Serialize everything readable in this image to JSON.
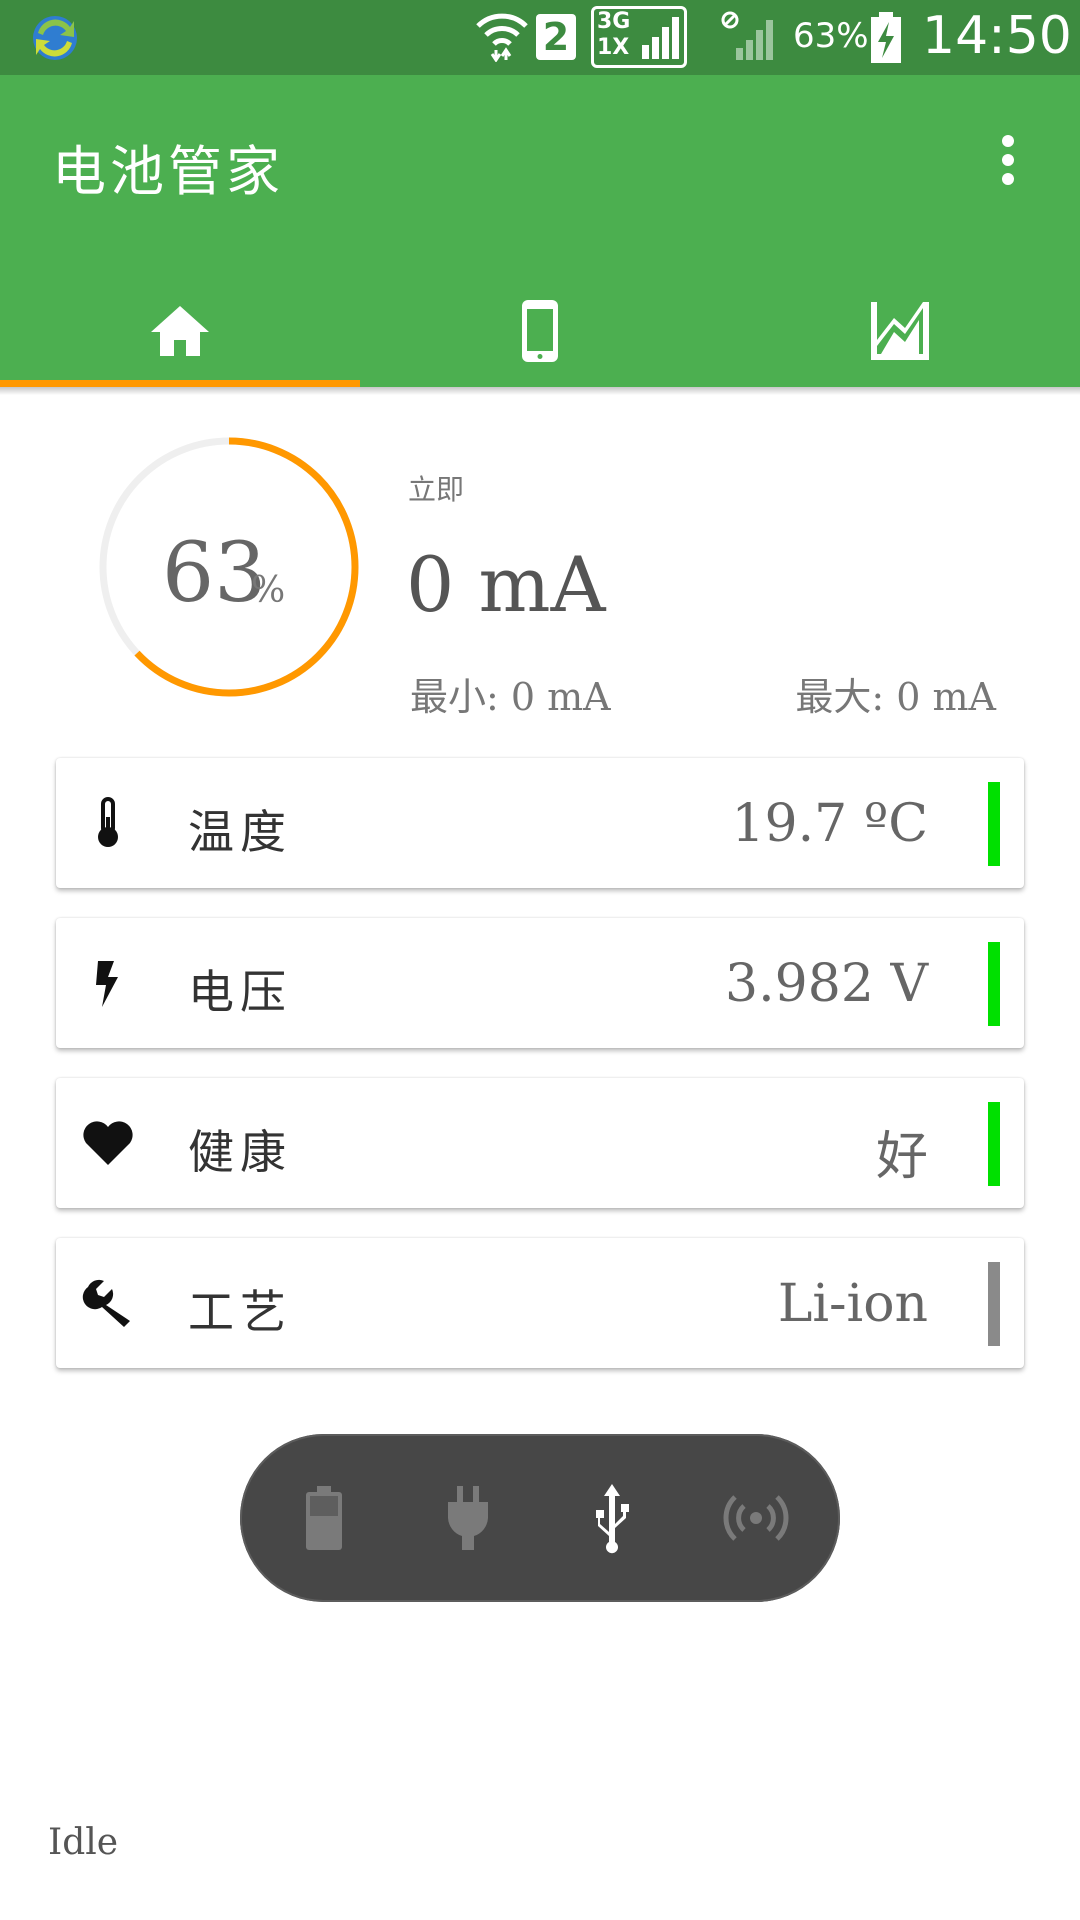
{
  "status_bar": {
    "battery_percent": "63%",
    "time": "14:50",
    "sim_slot": "2",
    "network_top": "3G",
    "network_bottom": "1X"
  },
  "toolbar": {
    "title": "电池管家",
    "tabs": [
      {
        "icon": "home-icon",
        "selected": true
      },
      {
        "icon": "phone-icon",
        "selected": false
      },
      {
        "icon": "chart-icon",
        "selected": false
      }
    ]
  },
  "gauge": {
    "percent_value": "63",
    "percent_unit": "%",
    "level_fraction": 0.63
  },
  "current": {
    "label": "立即",
    "value": "0 mA",
    "min": "最小: 0 mA",
    "max": "最大: 0 mA"
  },
  "cards": [
    {
      "icon": "thermometer-icon",
      "label": "温度",
      "value": "19.7 ºC",
      "indicator_color": "#00e000"
    },
    {
      "icon": "lightning-icon",
      "label": "电压",
      "value": "3.982 V",
      "indicator_color": "#00e000"
    },
    {
      "icon": "heart-icon",
      "label": "健康",
      "value": "好",
      "indicator_color": "#00e000"
    },
    {
      "icon": "wrench-icon",
      "label": "工艺",
      "value": "Li-ion",
      "indicator_color": "#8a8a8a"
    }
  ],
  "power_source": {
    "options": [
      "battery-icon",
      "plug-icon",
      "usb-icon",
      "wireless-icon"
    ],
    "active": "usb-icon"
  },
  "status_text": "Idle",
  "colors": {
    "status_bar": "#3d8b40",
    "toolbar": "#4caf50",
    "accent": "#ff9800",
    "good": "#00e000"
  }
}
